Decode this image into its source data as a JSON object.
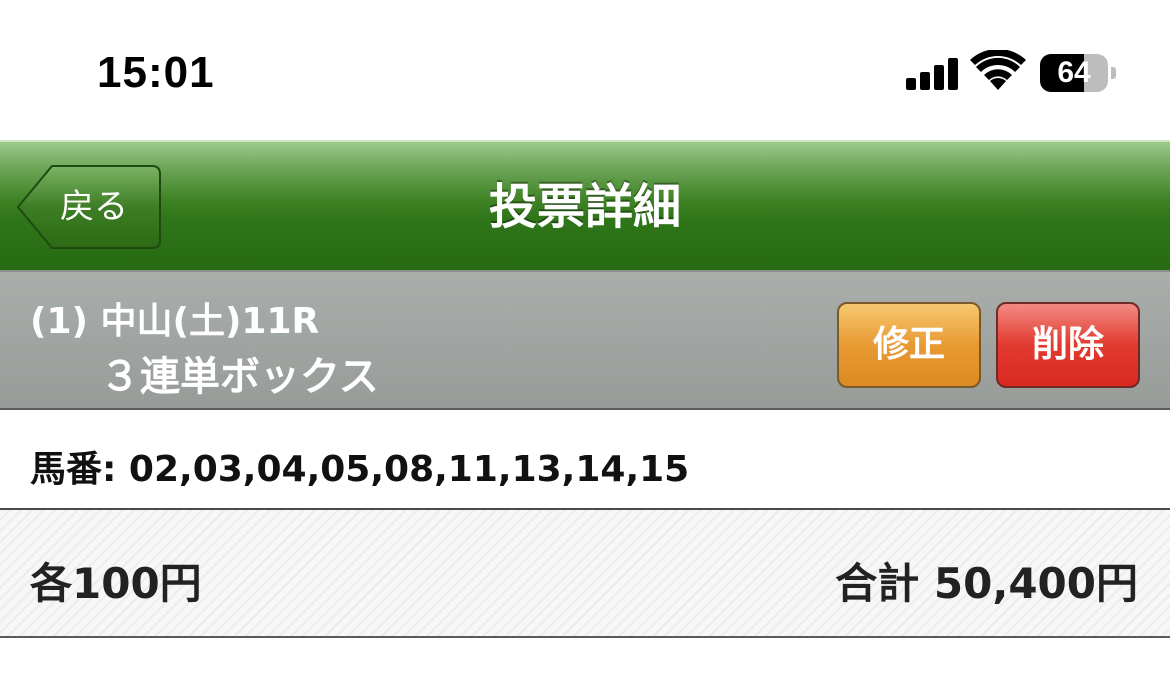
{
  "status_bar": {
    "time": "15:01",
    "battery_level": "64",
    "battery_fraction": 0.64,
    "icons": [
      "signal-icon",
      "wifi-icon",
      "battery-icon"
    ]
  },
  "nav": {
    "back_label": "戻る",
    "title": "投票詳細"
  },
  "race": {
    "line1": "(1) 中山(土)11R",
    "line2": "３連単ボックス",
    "edit_label": "修正",
    "delete_label": "削除"
  },
  "horses": {
    "text": "馬番: 02,03,04,05,08,11,13,14,15"
  },
  "amount": {
    "unit_price": "各100円",
    "total": "合計 50,400円"
  },
  "colors": {
    "nav_green": "#3f8426",
    "header_gray": "#979c99",
    "edit_orange": "#e89a33",
    "delete_red": "#e23a2f"
  }
}
